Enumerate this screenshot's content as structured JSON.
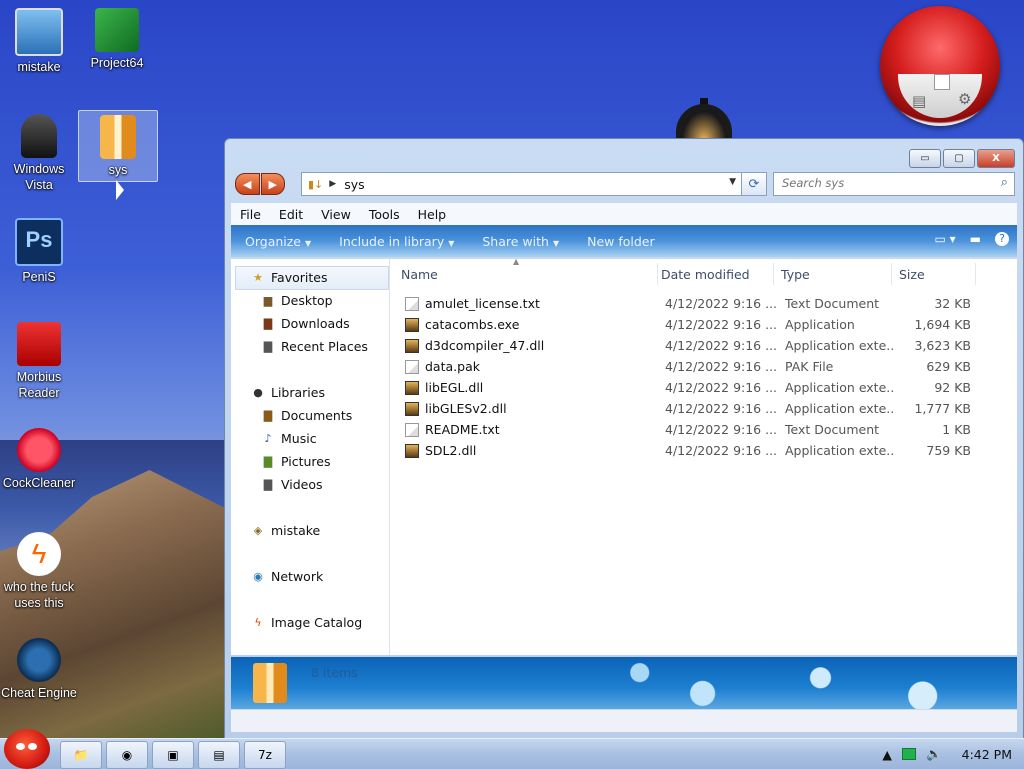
{
  "desktop": {
    "icons": [
      {
        "label": "mistake",
        "icon": "computer-icon"
      },
      {
        "label": "Project64",
        "icon": "project64-icon"
      },
      {
        "label": "Windows Vista",
        "icon": "trash-bin-icon"
      },
      {
        "label": "sys",
        "icon": "folder-icon"
      },
      {
        "label": "PeniS",
        "icon": "photoshop-icon"
      },
      {
        "label": "Morbius Reader",
        "icon": "pdf-reader-icon"
      },
      {
        "label": "CockCleaner",
        "icon": "ccleaner-icon"
      },
      {
        "label": "who the fuck uses this",
        "icon": "lightning-icon"
      },
      {
        "label": "Cheat Engine",
        "icon": "cheat-engine-icon"
      }
    ]
  },
  "window": {
    "title_buttons": {
      "minimize": "▭",
      "maximize": "▢",
      "close": "X"
    },
    "address": {
      "path": "sys"
    },
    "search": {
      "placeholder": "Search sys"
    },
    "menu": [
      "File",
      "Edit",
      "View",
      "Tools",
      "Help"
    ],
    "toolbar": {
      "organize": "Organize",
      "include_in_library": "Include in library",
      "share_with": "Share with",
      "new_folder": "New folder",
      "help": "?"
    },
    "nav": {
      "favorites": "Favorites",
      "desktop": "Desktop",
      "downloads": "Downloads",
      "recent_places": "Recent Places",
      "libraries": "Libraries",
      "documents": "Documents",
      "music": "Music",
      "pictures": "Pictures",
      "videos": "Videos",
      "homegroup": "mistake",
      "network": "Network",
      "image_catalog": "Image Catalog"
    },
    "columns": {
      "name": "Name",
      "date": "Date modified",
      "type": "Type",
      "size": "Size"
    },
    "files": [
      {
        "name": "amulet_license.txt",
        "date": "4/12/2022 9:16 ...",
        "type": "Text Document",
        "size": "32 KB",
        "kind": "doc"
      },
      {
        "name": "catacombs.exe",
        "date": "4/12/2022 9:16 ...",
        "type": "Application",
        "size": "1,694 KB",
        "kind": "exe"
      },
      {
        "name": "d3dcompiler_47.dll",
        "date": "4/12/2022 9:16 ...",
        "type": "Application exte...",
        "size": "3,623 KB",
        "kind": "exe"
      },
      {
        "name": "data.pak",
        "date": "4/12/2022 9:16 ...",
        "type": "PAK File",
        "size": "629 KB",
        "kind": "doc"
      },
      {
        "name": "libEGL.dll",
        "date": "4/12/2022 9:16 ...",
        "type": "Application exte...",
        "size": "92 KB",
        "kind": "exe"
      },
      {
        "name": "libGLESv2.dll",
        "date": "4/12/2022 9:16 ...",
        "type": "Application exte...",
        "size": "1,777 KB",
        "kind": "exe"
      },
      {
        "name": "README.txt",
        "date": "4/12/2022 9:16 ...",
        "type": "Text Document",
        "size": "1 KB",
        "kind": "doc"
      },
      {
        "name": "SDL2.dll",
        "date": "4/12/2022 9:16 ...",
        "type": "Application exte...",
        "size": "759 KB",
        "kind": "exe"
      }
    ],
    "status": {
      "item_count": "8 items"
    }
  },
  "taskbar": {
    "pinned": [
      {
        "name": "explorer-icon",
        "glyph": "📁"
      },
      {
        "name": "chrome-icon",
        "glyph": "◉"
      },
      {
        "name": "network-app-icon",
        "glyph": "▣"
      },
      {
        "name": "folder-task-icon",
        "glyph": "▤"
      },
      {
        "name": "seven-zip-icon",
        "glyph": "7z"
      }
    ],
    "clock": "4:42 PM"
  }
}
